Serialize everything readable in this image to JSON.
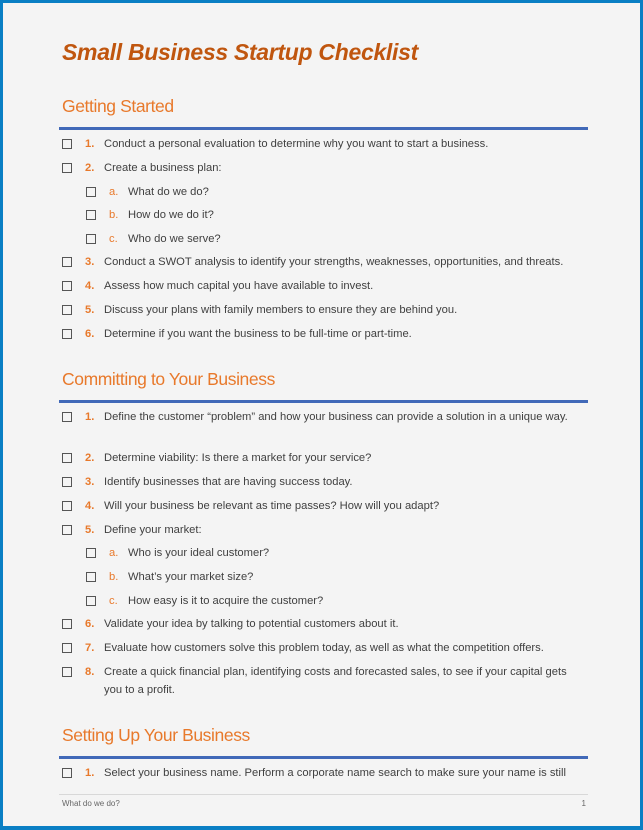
{
  "document": {
    "title": "Small Business Startup Checklist",
    "footer": {
      "left_text": "What do we do?",
      "page_number": "1"
    }
  },
  "sections": [
    {
      "heading": "Getting Started",
      "items": [
        {
          "num": "1.",
          "text": "Conduct a personal evaluation to determine why you want to start a business.",
          "checked": false
        },
        {
          "num": "2.",
          "text": "Create a business plan:",
          "checked": false
        },
        {
          "num": "a.",
          "text": "What do we do?",
          "checked": false,
          "sub": true
        },
        {
          "num": "b.",
          "text": "How do we do it?",
          "checked": false,
          "sub": true
        },
        {
          "num": "c.",
          "text": "Who do we serve?",
          "checked": false,
          "sub": true
        },
        {
          "num": "3.",
          "text": "Conduct a SWOT analysis to identify your strengths, weaknesses, opportunities, and threats.",
          "checked": false
        },
        {
          "num": "4.",
          "text": "Assess how much capital you have available to invest.",
          "checked": false
        },
        {
          "num": "5.",
          "text": "Discuss your plans with family members to ensure they are behind you.",
          "checked": false
        },
        {
          "num": "6.",
          "text": "Determine if you want the business to be full-time or part-time.",
          "checked": false
        }
      ]
    },
    {
      "heading": "Committing to Your Business",
      "items": [
        {
          "num": "1.",
          "text": "Define the customer “problem” and how your business can provide a solution in a unique way.",
          "checked": false
        },
        {
          "num": "2.",
          "text": "Determine viability: Is there a market for your service?",
          "checked": false
        },
        {
          "num": "3.",
          "text": "Identify businesses that are having success today.",
          "checked": false
        },
        {
          "num": "4.",
          "text": "Will your business be relevant as time passes? How will you adapt?",
          "checked": false
        },
        {
          "num": "5.",
          "text": "Define your market:",
          "checked": false
        },
        {
          "num": "a.",
          "text": "Who is your ideal customer?",
          "checked": false,
          "sub": true
        },
        {
          "num": "b.",
          "text": "What’s your market size?",
          "checked": false,
          "sub": true
        },
        {
          "num": "c.",
          "text": "How easy is it to acquire the customer?",
          "checked": false,
          "sub": true
        },
        {
          "num": "6.",
          "text": "Validate your idea by talking to potential customers about it.",
          "checked": false
        },
        {
          "num": "7.",
          "text": "Evaluate how customers solve this problem today, as well as what the competition offers.",
          "checked": false
        },
        {
          "num": "8.",
          "text": "Create a quick financial plan, identifying costs and forecasted sales, to see if your capital gets you to a profit.",
          "checked": false
        }
      ]
    },
    {
      "heading": "Setting Up Your Business",
      "items": [
        {
          "num": "1.",
          "text": "Select your business name. Perform a corporate name search to make sure your name is still",
          "checked": false
        }
      ]
    }
  ]
}
